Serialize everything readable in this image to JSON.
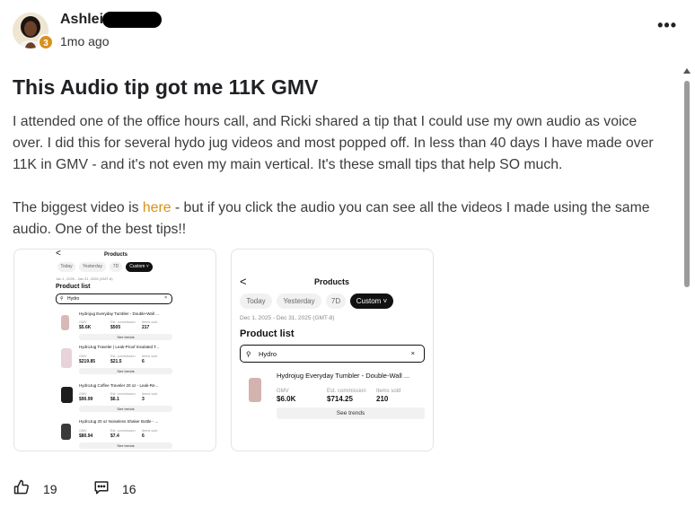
{
  "post": {
    "author": "Ashlei",
    "level": "3",
    "time": "1mo ago",
    "more_icon": "more-horizontal-icon",
    "title": "This Audio tip got me 11K GMV",
    "paragraph1": "I attended one of the office hours call, and Ricki shared a tip that I could use my own audio as voice over. I did this for several hydo jug videos and most popped off. In less than 40 days I have made over 11K in GMV - and it's not even my main vertical. It's these small tips that help SO much.",
    "paragraph2_before": "The biggest video is ",
    "paragraph2_link": "here",
    "paragraph2_after": " - but if you click the audio you can see all the videos I made using the same audio. One of the best tips!!",
    "link_color": "#d9901c"
  },
  "thumb1": {
    "back": "<",
    "title": "Products",
    "chips": [
      "Today",
      "Yesterday",
      "7D",
      "Custom ˅"
    ],
    "date": "Jan 1, 2026 - Jan 31, 2026 (GMT-8)",
    "heading": "Product list",
    "search": "Hydro",
    "clear": "×",
    "products": [
      {
        "name": "Hydrojug Everyday Tumbler - Double-Wall ...",
        "gmv_label": "GMV",
        "gmv": "$5.6K",
        "comm_label": "Est. commission",
        "comm": "$505",
        "sold_label": "Items sold",
        "sold": "217",
        "trend": "See trends"
      },
      {
        "name": "HydroJug Traveler | Leak-Proof Insulated T...",
        "gmv_label": "GMV",
        "gmv": "$219.85",
        "comm_label": "Est. commission",
        "comm": "$21.5",
        "sold_label": "Items sold",
        "sold": "6",
        "trend": "See trends"
      },
      {
        "name": "HydroJug Coffee Traveler 20 oz - Leak-Re...",
        "gmv_label": "GMV",
        "gmv": "$90.99",
        "comm_label": "Est. commission",
        "comm": "$6.1",
        "sold_label": "Items sold",
        "sold": "3",
        "trend": "See trends"
      },
      {
        "name": "HydroJug 20 oz Noiseless Shaker Bottle - ...",
        "gmv_label": "GMV",
        "gmv": "$80.94",
        "comm_label": "Est. commission",
        "comm": "$7.4",
        "sold_label": "Items sold",
        "sold": "6",
        "trend": "See trends"
      }
    ]
  },
  "thumb2": {
    "back": "<",
    "title": "Products",
    "chips": [
      "Today",
      "Yesterday",
      "7D",
      "Custom ˅"
    ],
    "date": "Dec 1, 2025 - Dec 31, 2025 (GMT-8)",
    "heading": "Product list",
    "search": "Hydro",
    "clear": "×",
    "product": {
      "name": "Hydrojug Everyday Tumbler - Double-Wall ...",
      "gmv_label": "GMV",
      "gmv": "$6.0K",
      "comm_label": "Est. commission",
      "comm": "$714.25",
      "sold_label": "Items sold",
      "sold": "210",
      "trend": "See trends"
    }
  },
  "footer": {
    "likes": "19",
    "comments": "16",
    "like_icon": "thumbs-up-icon",
    "comment_icon": "comment-icon"
  }
}
